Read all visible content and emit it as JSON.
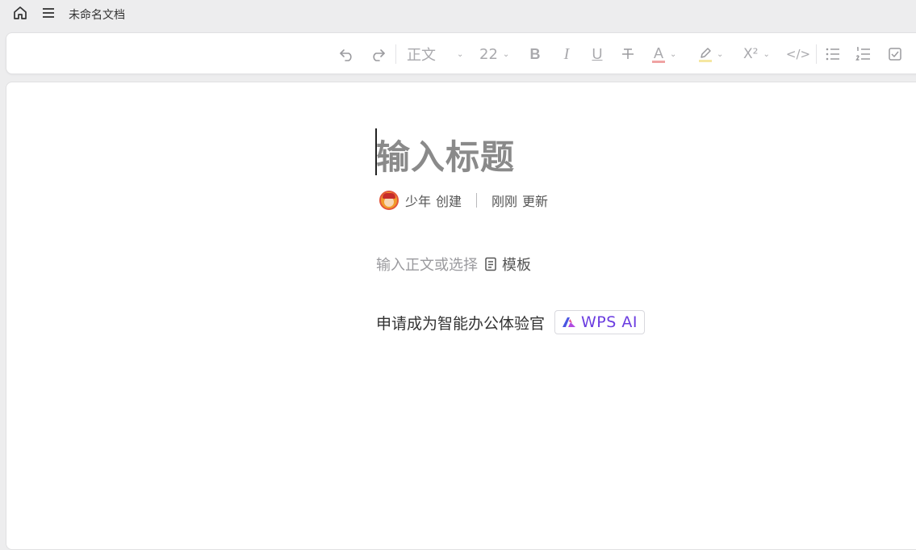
{
  "topbar": {
    "home_icon": "home-icon",
    "menu_icon": "hamburger-menu-icon",
    "doc_title": "未命名文档"
  },
  "toolbar": {
    "undo_icon": "undo-icon",
    "redo_icon": "redo-icon",
    "style_select": "正文",
    "font_size": "22",
    "bold_label": "B",
    "italic_label": "I",
    "underline_label": "U",
    "strike_icon": "strikethrough-icon",
    "font_color_label": "A",
    "font_color_accent": "#f0a3a3",
    "highlight_icon": "highlight-pen-icon",
    "highlight_accent": "#f5e7a1",
    "superscript_label": "X²",
    "code_label": "</>",
    "bullet_list_icon": "bullet-list-icon",
    "numbered_list_icon": "numbered-list-icon",
    "checklist_icon": "checkbox-list-icon"
  },
  "editor": {
    "title_placeholder": "输入标题",
    "author": "少年",
    "created_label": "创建",
    "updated_time": "刚刚",
    "updated_label": "更新",
    "body_placeholder": "输入正文或选择",
    "template_label": "模板",
    "ai_prompt": "申请成为智能办公体验官",
    "ai_badge": "WPS AI",
    "ai_brand_color": "#6b3de0"
  }
}
